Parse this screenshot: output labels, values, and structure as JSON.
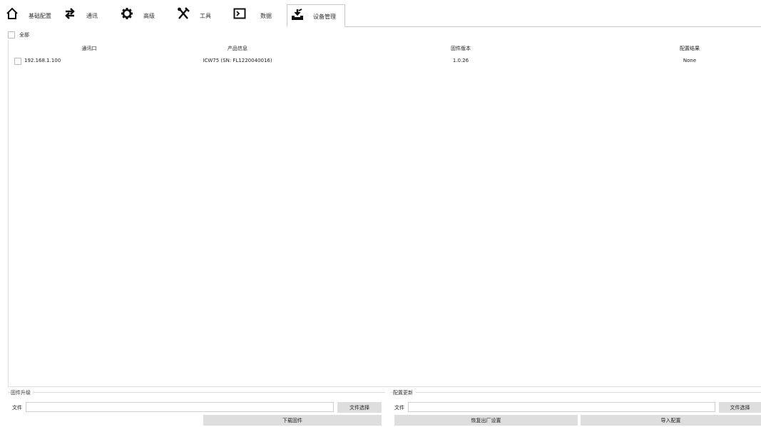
{
  "tabs": [
    {
      "label": "基础配置",
      "icon": "home-icon"
    },
    {
      "label": "通讯",
      "icon": "swap-arrows-icon"
    },
    {
      "label": "高级",
      "icon": "gear-icon"
    },
    {
      "label": "工具",
      "icon": "tools-icon"
    },
    {
      "label": "数据",
      "icon": "terminal-icon"
    },
    {
      "label": "设备管理",
      "icon": "device-download-icon",
      "active": true
    }
  ],
  "select_all_label": "全部",
  "table": {
    "columns": [
      "通讯口",
      "产品信息",
      "固件版本",
      "配置结果"
    ],
    "rows": [
      {
        "port": "192.168.1.100",
        "product": "ICW75 (SN: FL1220040016)",
        "firmware": "1.0.26",
        "result": "None",
        "checked": false
      }
    ]
  },
  "firmware_upgrade": {
    "title": "固件升级",
    "file_label": "文件",
    "file_value": "",
    "select_button": "文件选择",
    "download_button": "下载固件"
  },
  "config_update": {
    "title": "配置更新",
    "file_label": "文件",
    "file_value": "",
    "select_button": "文件选择",
    "restore_button": "恢复出厂设置",
    "import_button": "导入配置"
  }
}
